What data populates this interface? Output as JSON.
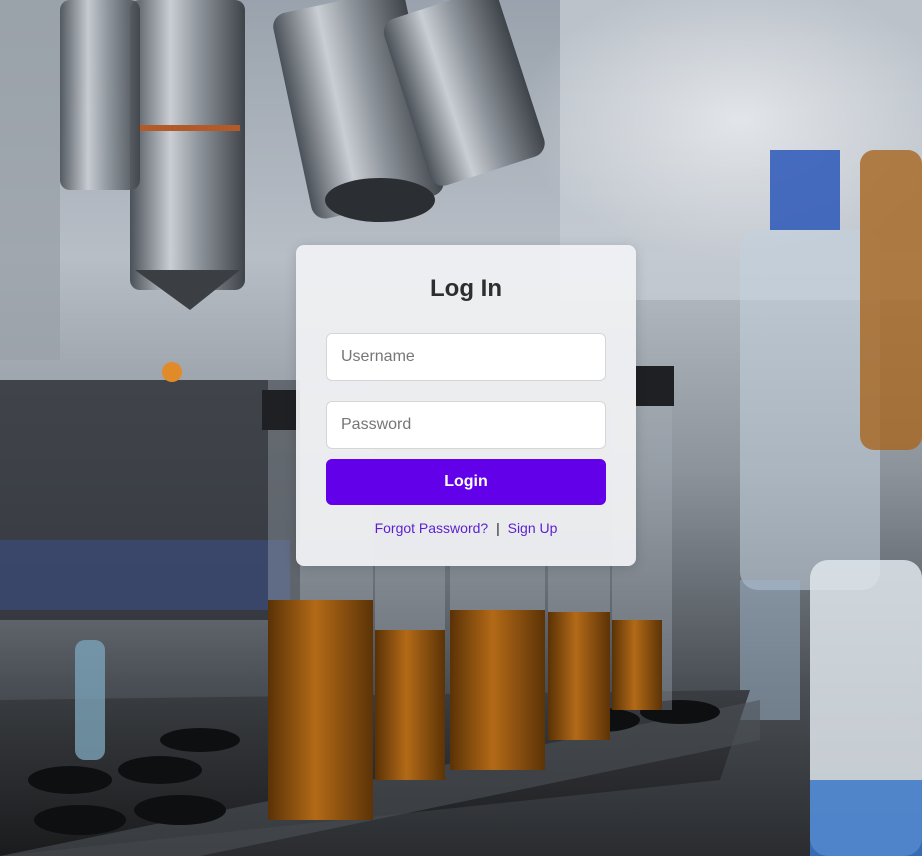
{
  "login": {
    "title": "Log In",
    "username_placeholder": "Username",
    "password_placeholder": "Password",
    "username_value": "",
    "password_value": "",
    "login_label": "Login",
    "forgot_label": "Forgot Password?",
    "separator": "|",
    "signup_label": "Sign Up"
  },
  "colors": {
    "accent": "#6200ea",
    "link": "#5b1fd0",
    "card_bg": "#f0f1f3"
  }
}
